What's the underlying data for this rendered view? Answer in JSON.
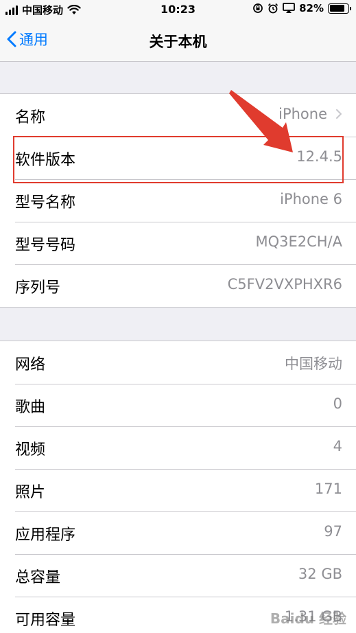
{
  "status_bar": {
    "carrier": "中国移动",
    "time": "10:23",
    "battery_percent": "82%",
    "battery_level": 0.82
  },
  "nav": {
    "back_label": "通用",
    "title": "关于本机"
  },
  "group1": [
    {
      "label": "名称",
      "value": "iPhone",
      "disclosure": true
    },
    {
      "label": "软件版本",
      "value": "12.4.5"
    },
    {
      "label": "型号名称",
      "value": "iPhone 6"
    },
    {
      "label": "型号号码",
      "value": "MQ3E2CH/A"
    },
    {
      "label": "序列号",
      "value": "C5FV2VXPHXR6"
    }
  ],
  "group2": [
    {
      "label": "网络",
      "value": "中国移动"
    },
    {
      "label": "歌曲",
      "value": "0"
    },
    {
      "label": "视频",
      "value": "4"
    },
    {
      "label": "照片",
      "value": "171"
    },
    {
      "label": "应用程序",
      "value": "97"
    },
    {
      "label": "总容量",
      "value": "32 GB"
    },
    {
      "label": "可用容量",
      "value": "1.31 GB"
    }
  ],
  "watermark": "Baidu 经验",
  "colors": {
    "accent": "#007aff",
    "annotation": "#e03b2e",
    "secondary_text": "#8e8e93",
    "background": "#efeff4"
  },
  "icons": [
    "signal-bars-icon",
    "wifi-icon",
    "rotation-lock-icon",
    "alarm-icon",
    "airplay-icon",
    "battery-icon",
    "back-chevron-icon",
    "disclosure-chevron-icon"
  ]
}
